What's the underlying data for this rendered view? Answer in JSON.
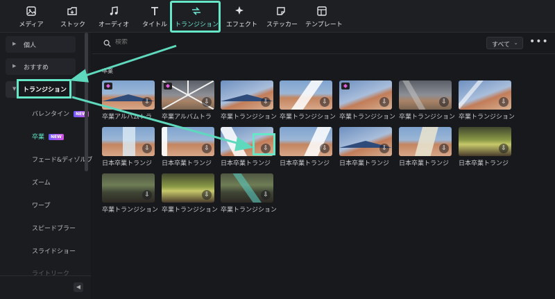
{
  "toolbar": {
    "tabs": [
      {
        "label": "メディア",
        "icon": "media-icon"
      },
      {
        "label": "ストック",
        "icon": "stock-icon"
      },
      {
        "label": "オーディオ",
        "icon": "audio-icon"
      },
      {
        "label": "タイトル",
        "icon": "title-icon"
      },
      {
        "label": "トランジション",
        "icon": "transition-icon"
      },
      {
        "label": "エフェクト",
        "icon": "effect-icon"
      },
      {
        "label": "ステッカー",
        "icon": "sticker-icon"
      },
      {
        "label": "テンプレート",
        "icon": "template-icon"
      }
    ],
    "active_tab": "トランジション"
  },
  "sidebar": {
    "sections": [
      {
        "label": "個人"
      },
      {
        "label": "おすすめ"
      },
      {
        "label": "トランジション"
      }
    ],
    "items": [
      {
        "label": "バレンタイン",
        "badge": "NEW"
      },
      {
        "label": "卒業",
        "badge": "NEW"
      },
      {
        "label": "フェード&ディゾルブ"
      },
      {
        "label": "ズーム"
      },
      {
        "label": "ワープ"
      },
      {
        "label": "スピードブラー"
      },
      {
        "label": "スライドショー"
      },
      {
        "label": "ライトリーク"
      }
    ],
    "collapse_icon": "chevron-left-icon"
  },
  "main": {
    "search_placeholder": "検索",
    "filter_value": "すべて",
    "more_label": "•••",
    "section_label": "卒業",
    "items": [
      {
        "caption": "卒業アルバムトラ",
        "premium": true
      },
      {
        "caption": "卒業アルバムトラ",
        "premium": true
      },
      {
        "caption": "卒業トランジション"
      },
      {
        "caption": "卒業トランジション"
      },
      {
        "caption": "卒業トランジション",
        "premium": true
      },
      {
        "caption": "卒業トランジション"
      },
      {
        "caption": "卒業トランジション"
      },
      {
        "caption": "日本卒業トランジ"
      },
      {
        "caption": "日本卒業トランジ"
      },
      {
        "caption": "日本卒業トランジ"
      },
      {
        "caption": "日本卒業トランジ"
      },
      {
        "caption": "日本卒業トランジ"
      },
      {
        "caption": "日本卒業トランジ"
      },
      {
        "caption": "日本卒業トランジ"
      },
      {
        "caption": "卒業トランジション"
      },
      {
        "caption": "卒業トランジション"
      },
      {
        "caption": "卒業トランジション"
      }
    ]
  },
  "colors": {
    "accent": "#66e7c7",
    "background": "#18191c",
    "new_badge": "#b456e8",
    "premium_gem": "#e05ce0"
  }
}
